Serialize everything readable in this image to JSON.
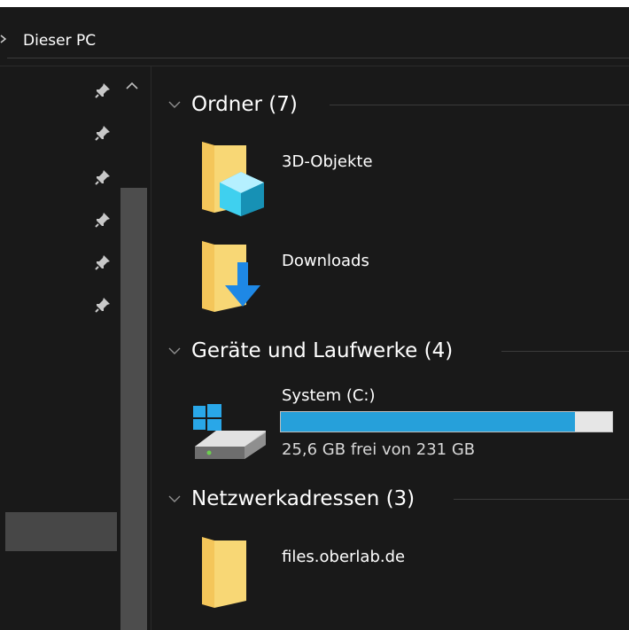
{
  "address_bar": {
    "location": "Dieser PC",
    "chevron_icon": "chevron-right-icon"
  },
  "sidebar": {
    "pins": [
      {
        "icon": "pin-icon"
      },
      {
        "icon": "pin-icon"
      },
      {
        "icon": "pin-icon"
      },
      {
        "icon": "pin-icon"
      },
      {
        "icon": "pin-icon"
      },
      {
        "icon": "pin-icon"
      }
    ],
    "scroll_up_icon": "chevron-up-icon"
  },
  "groups": {
    "folders": {
      "title": "Ordner (7)",
      "items": [
        {
          "label": "3D-Objekte",
          "icon": "3d-objects-folder-icon"
        },
        {
          "label": "Downloads",
          "icon": "downloads-folder-icon"
        }
      ]
    },
    "drives": {
      "title": "Geräte und Laufwerke (4)",
      "items": [
        {
          "label": "System (C:)",
          "icon": "windows-drive-icon",
          "free_text": "25,6 GB frei von 231 GB",
          "used_fraction": 0.889
        }
      ]
    },
    "network": {
      "title": "Netzwerkadressen (3)",
      "items": [
        {
          "label": "files.oberlab.de",
          "icon": "network-folder-icon"
        }
      ]
    }
  },
  "colors": {
    "background": "#191919",
    "accent_bar": "#26a0da",
    "bar_track": "#e6e6e6",
    "folder_yellow": "#f8d775",
    "download_blue": "#1e88e5"
  }
}
